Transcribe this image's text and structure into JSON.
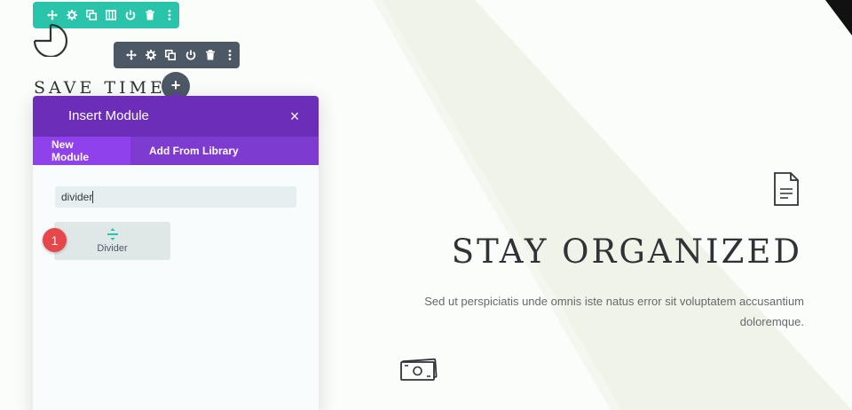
{
  "teal_toolbar": {
    "icons": [
      "move-icon",
      "settings-icon",
      "duplicate-icon",
      "columns-icon",
      "power-icon",
      "trash-icon",
      "more-icon"
    ]
  },
  "dark_toolbar": {
    "icons": [
      "move-icon",
      "settings-icon",
      "duplicate-icon",
      "power-icon",
      "trash-icon",
      "more-icon"
    ]
  },
  "page": {
    "save_title": "SAVE TIME",
    "stay_title": "STAY ORGANIZED",
    "body_text": "Sed ut perspiciatis unde omnis iste natus error sit voluptatem accusantium doloremque."
  },
  "add_button": {
    "label": "+"
  },
  "modal": {
    "title": "Insert Module",
    "close_label": "×",
    "tabs": [
      {
        "label": "New Module",
        "active": true
      },
      {
        "label": "Add From Library",
        "active": false
      }
    ],
    "search_value": "divider",
    "result": {
      "label": "Divider",
      "icon": "divider-icon"
    }
  },
  "step_badge": {
    "label": "1"
  },
  "colors": {
    "purple_header": "#6c2eb9",
    "purple_tabs": "#7e3bd0",
    "purple_active_tab": "#8f42ec",
    "teal_toolbar": "#29c4a9",
    "dark_toolbar": "#4c5866",
    "badge_red": "#e5474b",
    "divider_icon": "#29c4a9"
  }
}
